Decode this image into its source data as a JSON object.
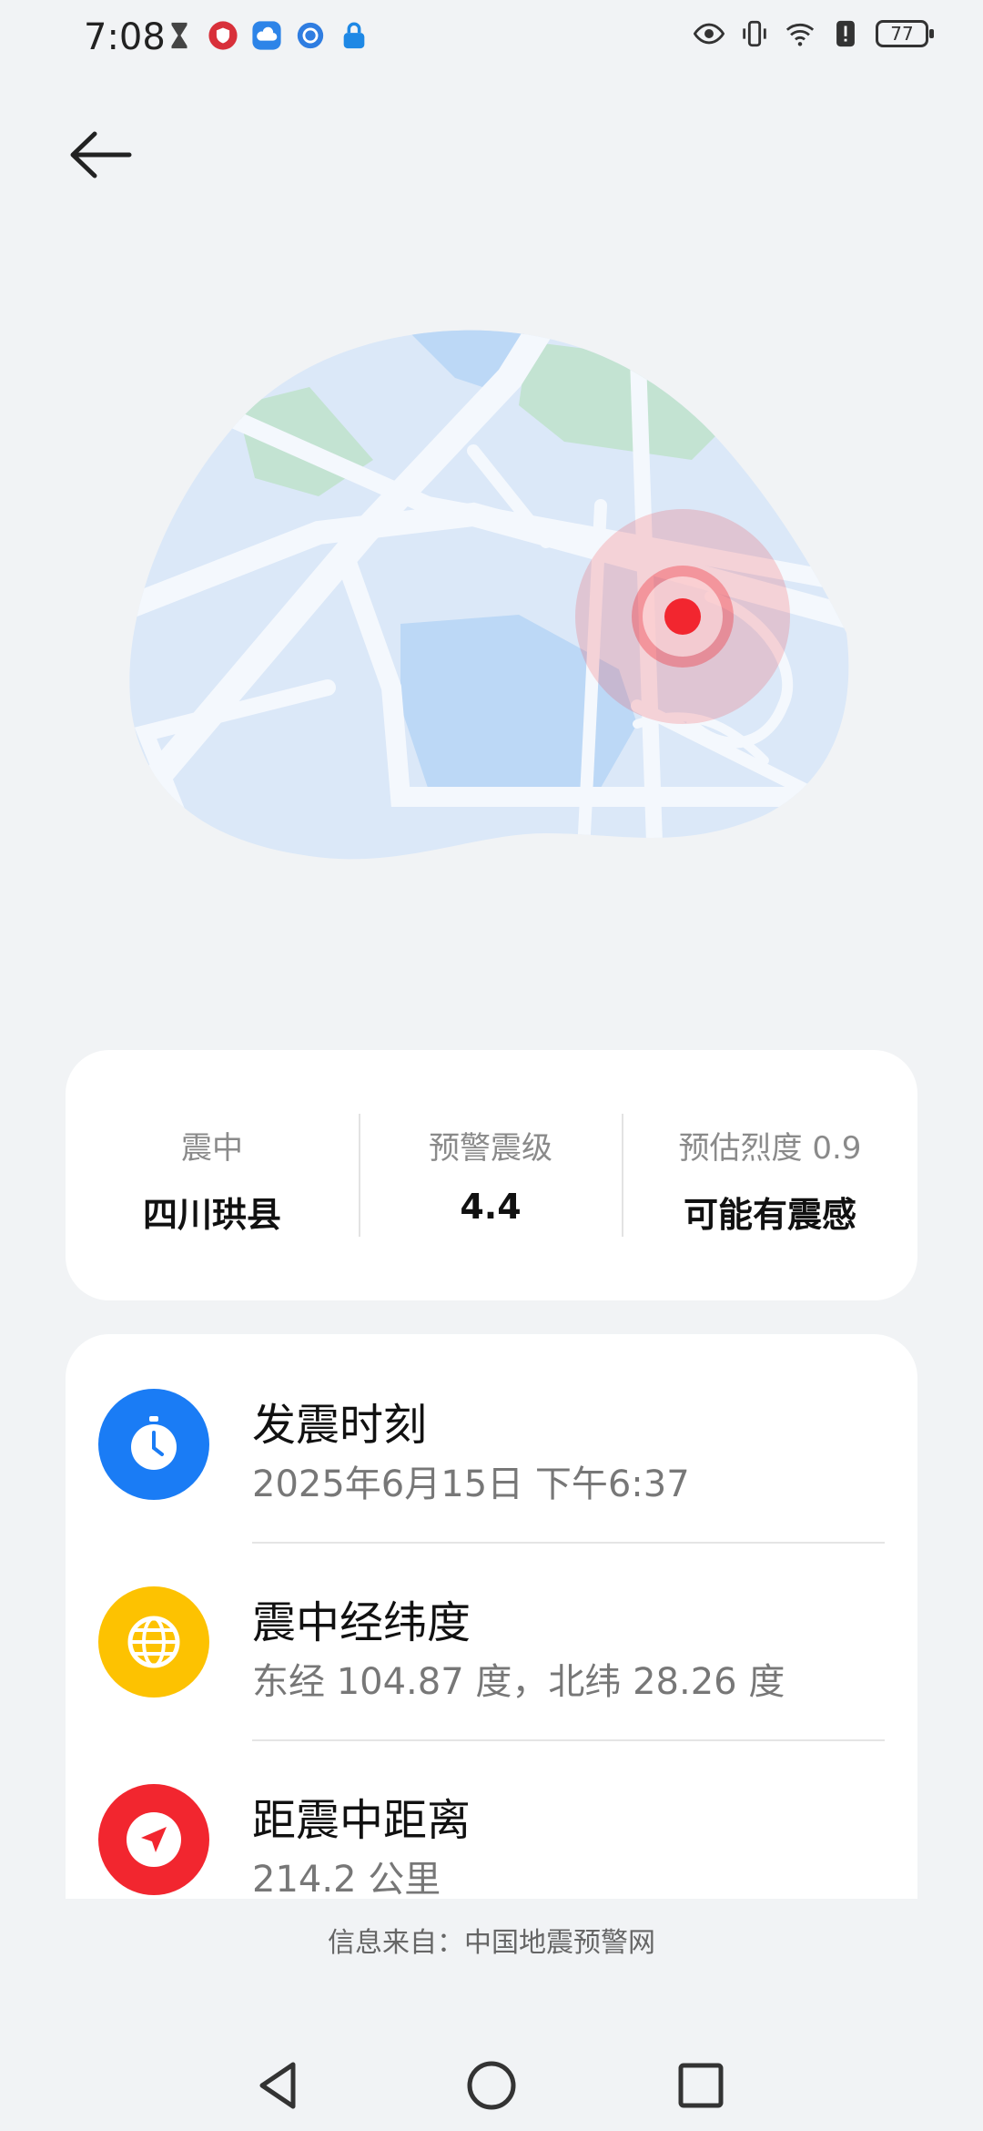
{
  "status_bar": {
    "time": "7:08",
    "battery": "77",
    "left_icons": [
      "hourglass-icon",
      "shield-icon",
      "cloud-icon",
      "globe-icon",
      "lock-icon"
    ],
    "right_icons": [
      "eye-icon",
      "vibrate-icon",
      "wifi-icon",
      "alert-icon",
      "battery-icon"
    ]
  },
  "summary": {
    "epicenter_label": "震中",
    "epicenter_value": "四川珙县",
    "magnitude_label": "预警震级",
    "magnitude_value": "4.4",
    "intensity_label": "预估烈度 0.9",
    "intensity_value": "可能有震感"
  },
  "details": [
    {
      "title": "发震时刻",
      "value": "2025年6月15日 下午6:37",
      "icon": "clock-icon",
      "color": "#1a7cf5"
    },
    {
      "title": "震中经纬度",
      "value": "东经 104.87 度，北纬 28.26 度",
      "icon": "globe-icon",
      "color": "#fdc201"
    },
    {
      "title": "距震中距离",
      "value": "214.2 公里",
      "icon": "navigation-arrow-icon",
      "color": "#f2262f"
    }
  ],
  "source": "信息来自：中国地震预警网",
  "colors": {
    "accent_red": "#f2262f",
    "map_blue": "#dbe8f8",
    "map_green": "#bfe3cf"
  }
}
